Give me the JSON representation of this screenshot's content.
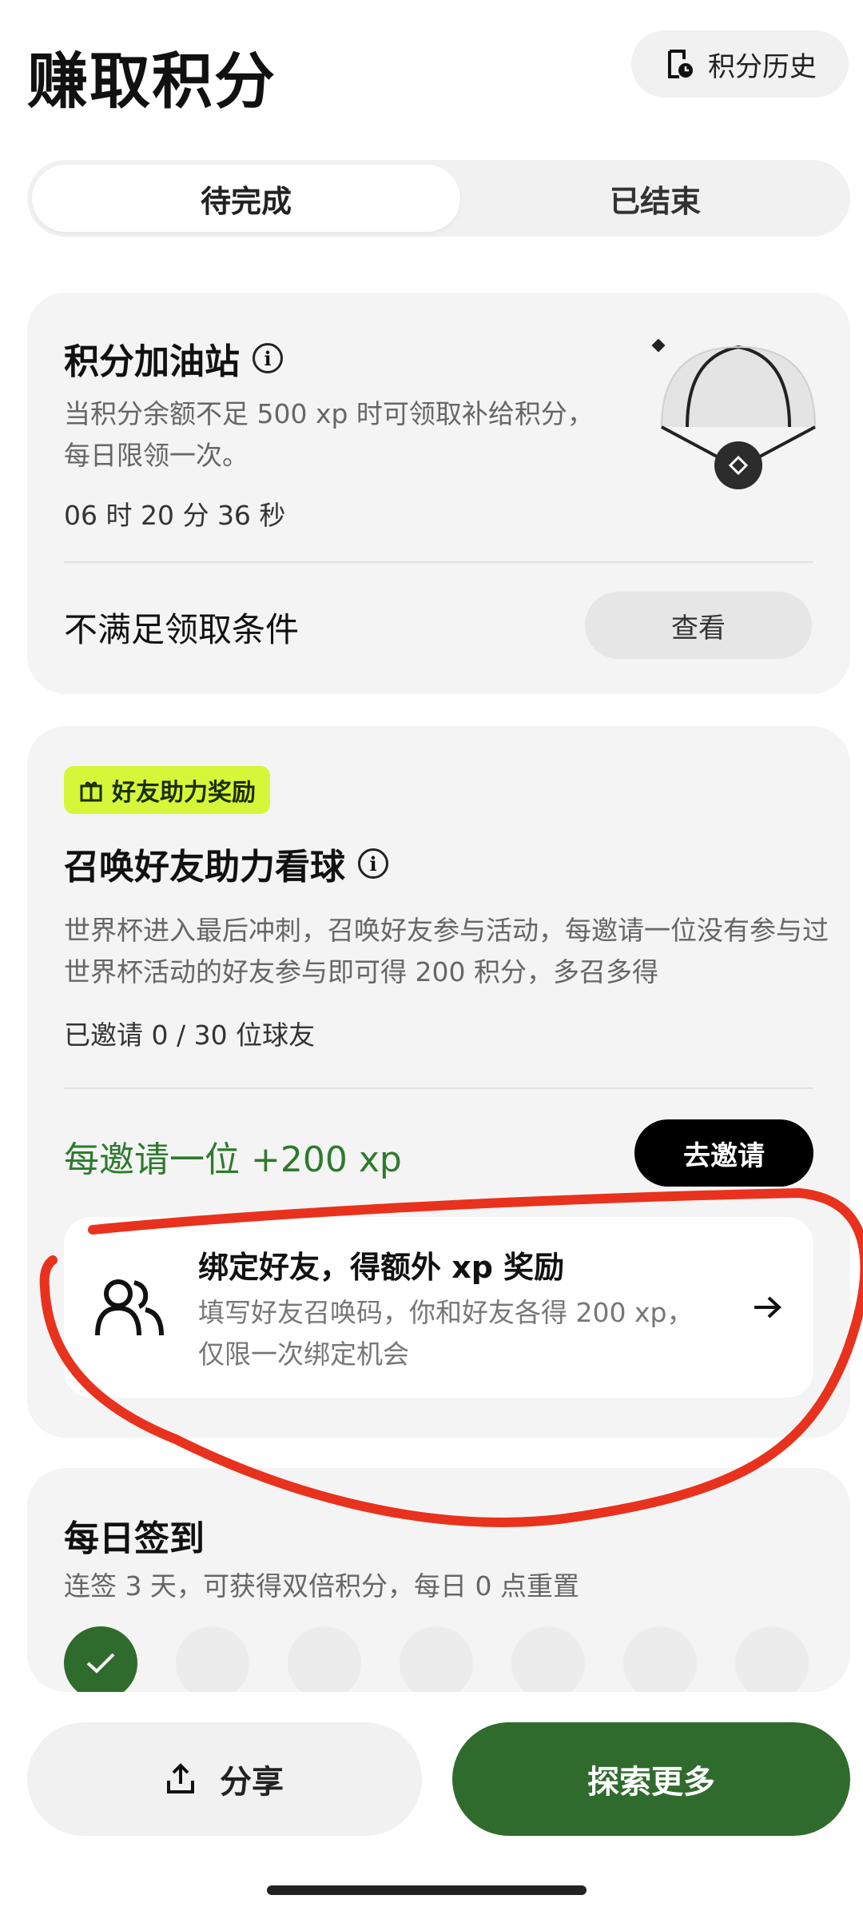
{
  "header": {
    "title": "赚取积分",
    "history_label": "积分历史",
    "history_icon": "history-doc-icon"
  },
  "tabs": [
    {
      "label": "待完成",
      "active": true
    },
    {
      "label": "已结束",
      "active": false
    }
  ],
  "refuel_card": {
    "title": "积分加油站",
    "info_icon": "info-icon",
    "description": "当积分余额不足 500 xp 时可领取补给积分，每日限领一次。",
    "countdown": "06 时 20 分 36 秒",
    "status_text": "不满足领取条件",
    "view_label": "查看",
    "illustration": "parachute-icon"
  },
  "invite_card": {
    "badge_label": "好友助力奖励",
    "badge_icon": "gift-icon",
    "title": "召唤好友助力看球",
    "description": "世界杯进入最后冲刺，召唤好友参与活动，每邀请一位没有参与过世界杯活动的好友参与即可得 200 积分，多召多得",
    "progress_text": "已邀请 0 / 30 位球友",
    "invited": 0,
    "invite_total": 30,
    "reward_text": "每邀请一位 +200 xp",
    "invite_button": "去邀请",
    "bind": {
      "title": "绑定好友，得额外 xp 奖励",
      "description": "填写好友召唤码，你和好友各得 200 xp，仅限一次绑定机会",
      "icon": "friends-icon",
      "arrow_icon": "arrow-right-icon"
    }
  },
  "checkin_card": {
    "title": "每日签到",
    "description": "连签 3 天，可获得双倍积分，每日 0 点重置",
    "days_checked": 1,
    "days_total": 7
  },
  "bottom_bar": {
    "share_label": "分享",
    "share_icon": "share-icon",
    "explore_label": "探索更多"
  },
  "colors": {
    "accent_green": "#2f6b2d",
    "reward_green": "#2d7a2d",
    "badge_lime": "#d6f739",
    "annotation_red": "#e8321e"
  }
}
